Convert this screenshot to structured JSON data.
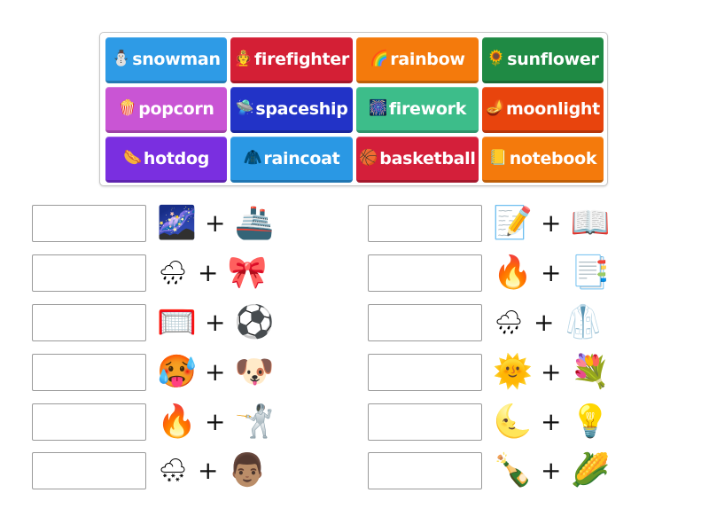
{
  "word_bank": {
    "tiles": [
      {
        "label": "snowman",
        "icon": "⛄",
        "icon_name": "snowman-icon",
        "color": "#2e9be6"
      },
      {
        "label": "firefighter",
        "icon": "🧑‍🚒",
        "icon_name": "firefighter-icon",
        "color": "#d41f35"
      },
      {
        "label": "rainbow",
        "icon": "🌈",
        "icon_name": "rainbow-icon",
        "color": "#f47a0c"
      },
      {
        "label": "sunflower",
        "icon": "🌻",
        "icon_name": "sunflower-icon",
        "color": "#1f8a44"
      },
      {
        "label": "popcorn",
        "icon": "🍿",
        "icon_name": "popcorn-icon",
        "color": "#c955d4"
      },
      {
        "label": "spaceship",
        "icon": "🛸",
        "icon_name": "ufo-icon",
        "color": "#2233c7"
      },
      {
        "label": "firework",
        "icon": "🎆",
        "icon_name": "firework-icon",
        "color": "#3dbd8a"
      },
      {
        "label": "moonlight",
        "icon": "🪔",
        "icon_name": "lamp-icon",
        "color": "#e8440d"
      },
      {
        "label": "hotdog",
        "icon": "🌭",
        "icon_name": "hotdog-icon",
        "color": "#7a2fe0"
      },
      {
        "label": "raincoat",
        "icon": "🧥",
        "icon_name": "coat-icon",
        "color": "#2a98e4"
      },
      {
        "label": "basketball",
        "icon": "🏀",
        "icon_name": "basketball-icon",
        "color": "#d41f3a"
      },
      {
        "label": "notebook",
        "icon": "📒",
        "icon_name": "notebook-icon",
        "color": "#f47a0c"
      }
    ]
  },
  "puzzles": {
    "left": [
      {
        "answer": "",
        "a": "🌌",
        "a_name": "galaxy-icon",
        "b": "🚢",
        "b_name": "ship-icon"
      },
      {
        "answer": "",
        "a": "🌧",
        "a_name": "rain-cloud-icon",
        "b": "🎀",
        "b_name": "ribbon-bow-icon"
      },
      {
        "answer": "",
        "a": "🥅",
        "a_name": "basket-net-icon",
        "b": "⚽",
        "b_name": "soccer-ball-icon"
      },
      {
        "answer": "",
        "a": "🥵",
        "a_name": "hot-face-icon",
        "b": "🐶",
        "b_name": "dog-icon"
      },
      {
        "answer": "",
        "a": "🔥",
        "a_name": "fire-icon",
        "b": "🤺",
        "b_name": "fencer-icon"
      },
      {
        "answer": "",
        "a": "🌨",
        "a_name": "snow-cloud-icon",
        "b": "👨🏽",
        "b_name": "man-icon"
      }
    ],
    "right": [
      {
        "answer": "",
        "a": "📝",
        "a_name": "memo-icon",
        "b": "📖",
        "b_name": "open-book-icon"
      },
      {
        "answer": "",
        "a": "🔥",
        "a_name": "fire-icon",
        "b": "📑",
        "b_name": "bookmark-tabs-icon"
      },
      {
        "answer": "",
        "a": "🌧",
        "a_name": "rain-cloud-icon",
        "b": "🥼",
        "b_name": "lab-coat-icon"
      },
      {
        "answer": "",
        "a": "🌞",
        "a_name": "sun-icon",
        "b": "💐",
        "b_name": "bouquet-icon"
      },
      {
        "answer": "",
        "a": "🌜",
        "a_name": "crescent-moon-icon",
        "b": "💡",
        "b_name": "light-bulb-icon"
      },
      {
        "answer": "",
        "a": "🍾",
        "a_name": "champagne-icon",
        "b": "🌽",
        "b_name": "corn-icon"
      }
    ],
    "plus_sign": "+"
  }
}
